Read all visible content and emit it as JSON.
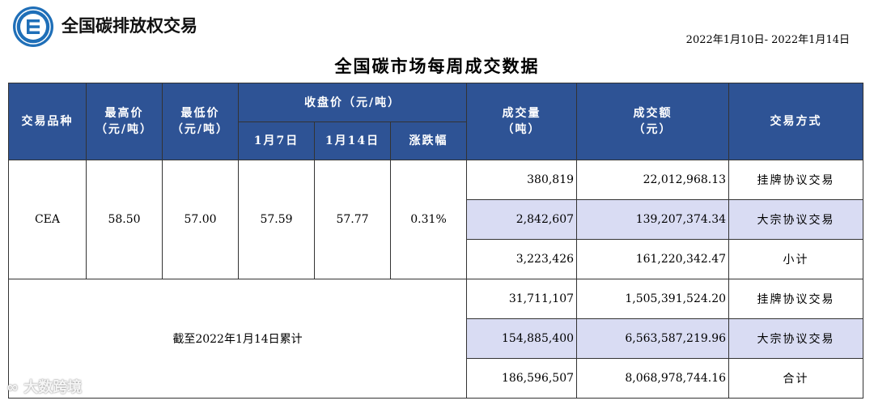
{
  "header": {
    "brand": "全国碳排放权交易",
    "date_range": "2022年1月10日- 2022年1月14日",
    "title": "全国碳市场每周成交数据"
  },
  "colors": {
    "header_bg": "#2e5395",
    "highlight_row": "#d9dcf3",
    "logo": "#1f6fb8"
  },
  "table": {
    "headers": {
      "product": "交易品种",
      "high": "最高价",
      "high_unit": "（元/吨）",
      "low": "最低价",
      "low_unit": "（元/吨）",
      "close": "收盘价（元/吨）",
      "close_d1": "1月7日",
      "close_d2": "1月14日",
      "change": "涨跌幅",
      "volume": "成交量",
      "volume_unit": "（吨）",
      "amount": "成交额",
      "amount_unit": "（元）",
      "method": "交易方式"
    },
    "cea": {
      "product": "CEA",
      "high": "58.50",
      "low": "57.00",
      "close_d1": "57.59",
      "close_d2": "57.77",
      "change": "0.31%",
      "rows": [
        {
          "volume": "380,819",
          "amount": "22,012,968.13",
          "method": "挂牌协议交易"
        },
        {
          "volume": "2,842,607",
          "amount": "139,207,374.34",
          "method": "大宗协议交易"
        },
        {
          "volume": "3,223,426",
          "amount": "161,220,342.47",
          "method": "小计"
        }
      ]
    },
    "cumulative": {
      "label": "截至2022年1月14日累计",
      "rows": [
        {
          "volume": "31,711,107",
          "amount": "1,505,391,524.20",
          "method": "挂牌协议交易"
        },
        {
          "volume": "154,885,400",
          "amount": "6,563,587,219.96",
          "method": "大宗协议交易"
        },
        {
          "volume": "186,596,507",
          "amount": "8,068,978,744.16",
          "method": "合计"
        }
      ]
    }
  },
  "watermark": "大数跨境"
}
